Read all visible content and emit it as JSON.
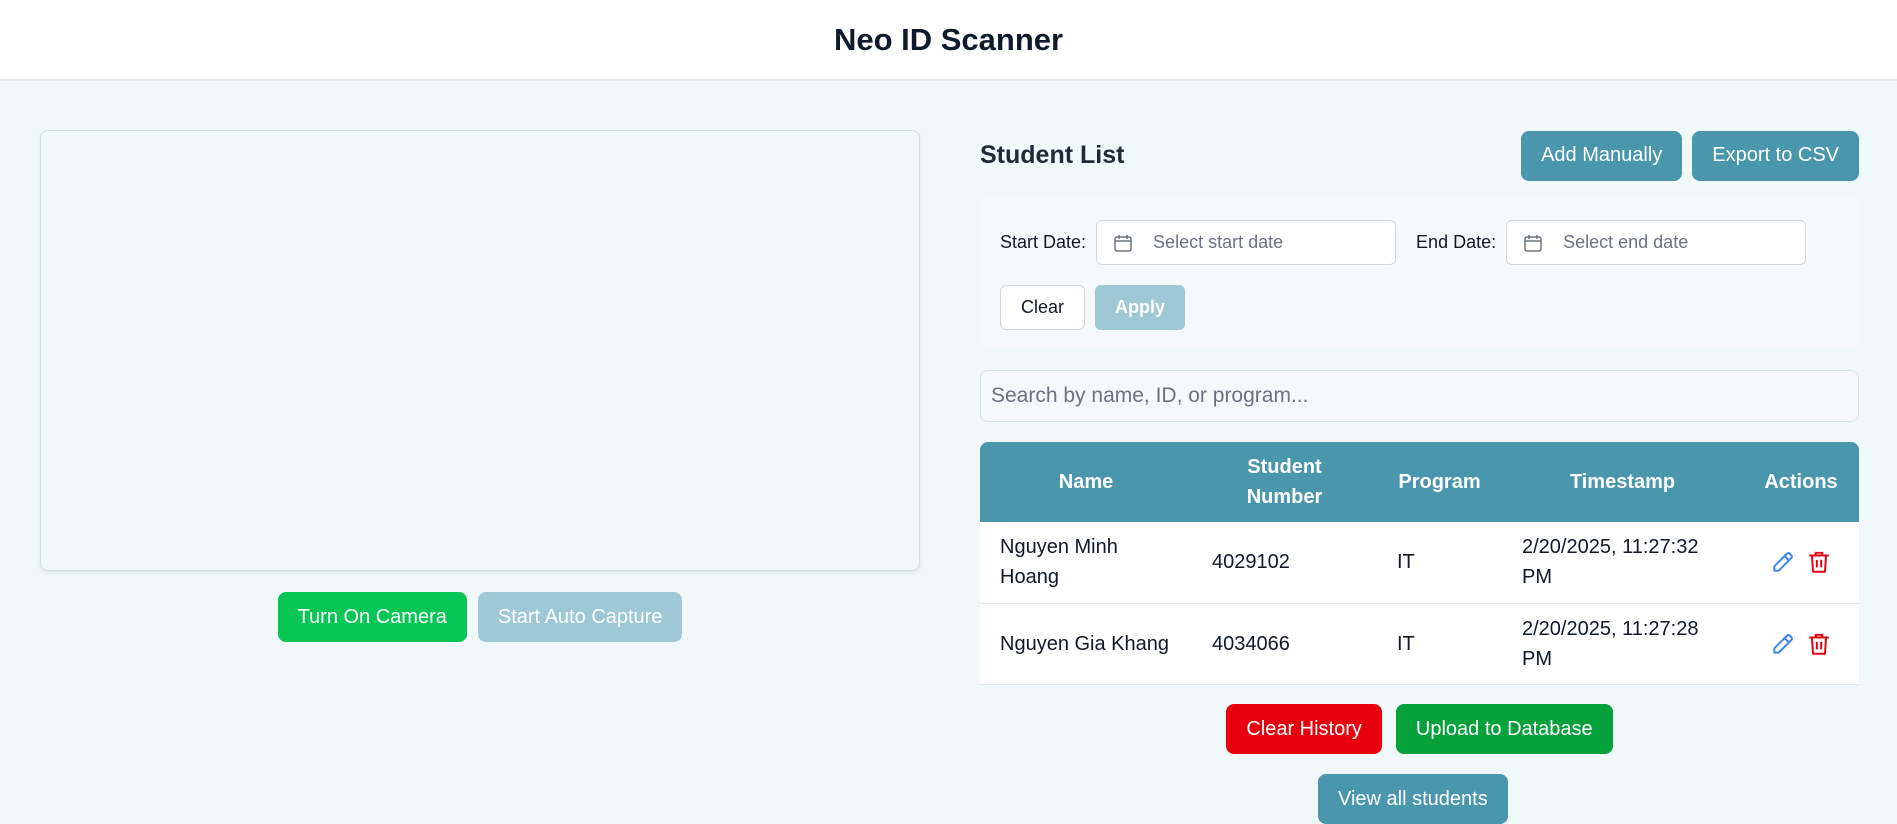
{
  "header": {
    "title": "Neo ID Scanner"
  },
  "camera": {
    "turn_on_label": "Turn On Camera",
    "auto_capture_label": "Start Auto Capture"
  },
  "student_list": {
    "title": "Student List",
    "add_manually_label": "Add Manually",
    "export_label": "Export to CSV",
    "filter": {
      "start_label": "Start Date:",
      "start_placeholder": "Select start date",
      "end_label": "End Date:",
      "end_placeholder": "Select end date",
      "clear_label": "Clear",
      "apply_label": "Apply"
    },
    "search_placeholder": "Search by name, ID, or program...",
    "columns": {
      "name": "Name",
      "student_number_line1": "Student",
      "student_number_line2": "Number",
      "program": "Program",
      "timestamp": "Timestamp",
      "actions": "Actions"
    },
    "rows": [
      {
        "name": "Nguyen Minh Hoang",
        "student_number": "4029102",
        "program": "IT",
        "timestamp": "2/20/2025, 11:27:32 PM"
      },
      {
        "name": "Nguyen Gia Khang",
        "student_number": "4034066",
        "program": "IT",
        "timestamp": "2/20/2025, 11:27:28 PM"
      }
    ],
    "clear_history_label": "Clear History",
    "upload_label": "Upload to Database",
    "view_all_label": "View all students"
  },
  "colors": {
    "accent": "#4a97ad",
    "green": "#06c755",
    "red": "#e8000f",
    "edit_icon": "#3b82f6",
    "delete_icon": "#e8000f"
  },
  "icons": [
    "calendar-icon",
    "edit-icon",
    "delete-icon"
  ]
}
